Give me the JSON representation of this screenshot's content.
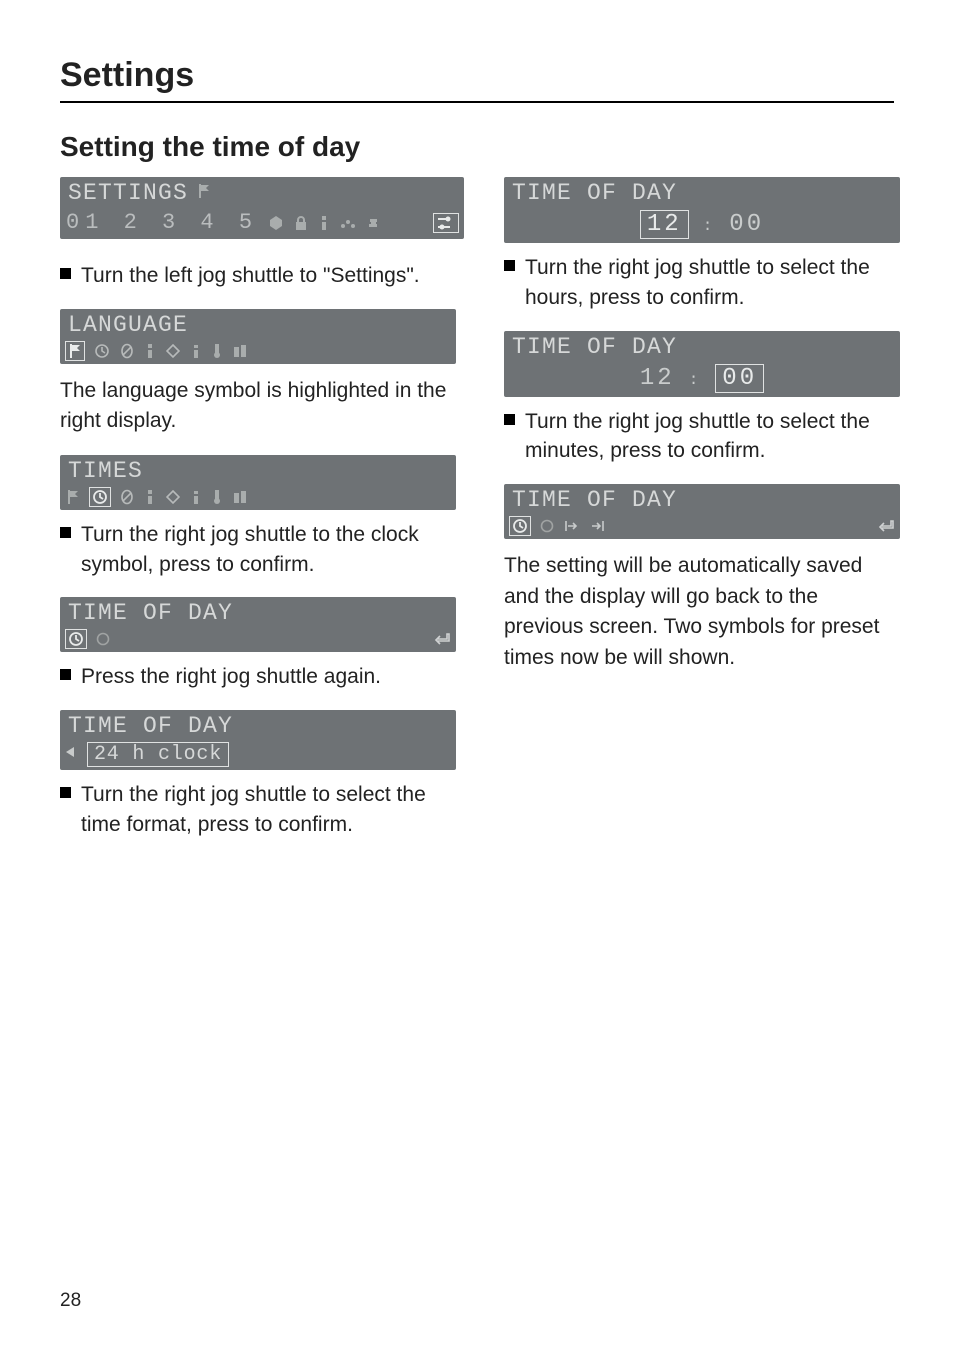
{
  "page_number": "28",
  "heading": "Settings",
  "subheading": "Setting the time of day",
  "left": {
    "settings_lcd": {
      "title": "SETTINGS",
      "row_text": "01 2 3 4 5"
    },
    "step1": "Turn the left jog shuttle to \"Settings\".",
    "language_lcd": {
      "title": "LANGUAGE"
    },
    "after_language": "The language symbol is highlighted in the right display.",
    "times_lcd": {
      "title": "TIMES"
    },
    "step2": "Turn the right jog shuttle to the clock symbol, press to confirm.",
    "tod1_lcd": {
      "title": "TIME OF DAY"
    },
    "step3": "Press the right jog shuttle again.",
    "tod2_lcd": {
      "title": "TIME OF DAY",
      "option": "24 h clock"
    },
    "step4": "Turn the right jog shuttle to select the time format, press to confirm."
  },
  "right": {
    "tod3_lcd": {
      "title": "TIME OF DAY",
      "hours": "12",
      "minutes": "00"
    },
    "step5": "Turn the right jog shuttle to select the hours, press to confirm.",
    "tod4_lcd": {
      "title": "TIME OF DAY",
      "hours": "12",
      "minutes": "00"
    },
    "step6": "Turn the right jog shuttle to select the minutes, press to confirm.",
    "tod5_lcd": {
      "title": "TIME OF DAY"
    },
    "final": "The setting will be automatically saved and the display will go back to the previous screen. Two symbols for preset times now be will shown."
  }
}
